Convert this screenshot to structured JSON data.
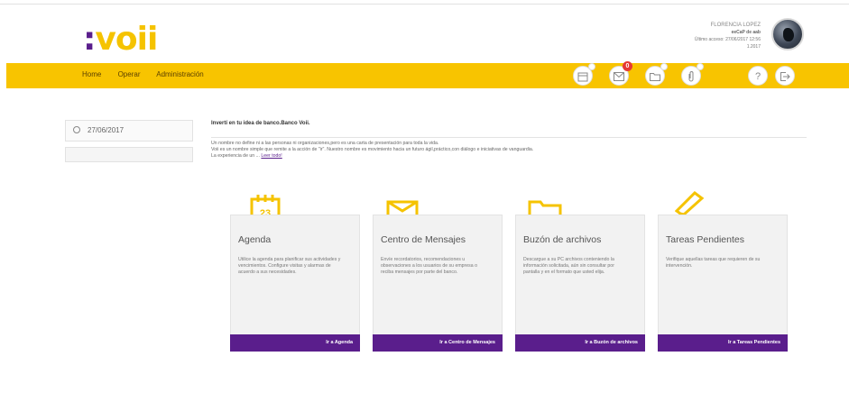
{
  "logo": {
    "colon": ":",
    "text": "voii"
  },
  "user": {
    "name": "FLORENCIA LOPEZ",
    "company": "eeCaP de aab",
    "last_access": "Último acceso: 27/06/2017 12:56",
    "id": "1.2017"
  },
  "nav": {
    "home": "Home",
    "operar": "Operar",
    "admin": "Administración",
    "badge_count": "0"
  },
  "icons": {
    "calendar": "calendar-icon",
    "mail": "mail-icon",
    "folder": "folder-icon",
    "clip": "paperclip-icon",
    "help": "help-icon",
    "logout": "logout-icon"
  },
  "sidebar": {
    "date": "27/06/2017"
  },
  "intro": {
    "title": "Invertí en tu idea de banco.Banco Voii.",
    "line1": "Un nombre no define ni a las personas ni organizaciones,pero es una carta de presentación para toda la vida.",
    "line2": "Voii es un nombre simple que remite a la acción de \"ir\". Nuestro nombre es movimiento hacia un futuro ágil,práctico,con diálogo e iniciativas de vanguardia.",
    "line3": "La experiencia de un ...",
    "more": "Leer todo!"
  },
  "cards": [
    {
      "title": "Agenda",
      "desc": "Utilice la agenda para planificar sus actividades y vencimientos. Configure visitas y alarmas de acuerdo a sus necesidades.",
      "button": "Ir a Agenda"
    },
    {
      "title": "Centro de Mensajes",
      "desc": "Envíe recordatorios, recomendaciones u observaciones a los usuarios de su empresa o reciba mensajes por parte del banco.",
      "button": "Ir a Centro de Mensajes"
    },
    {
      "title": "Buzón de archivos",
      "desc": "Descargue a su PC archivos conteniendo la información solicitada, aún sin consultar por pantalla y en el formato que usted elija.",
      "button": "Ir a Buzón de archivos"
    },
    {
      "title": "Tareas Pendientes",
      "desc": "Verifique aquellas tareas que requieren de su intervención.",
      "button": "Ir a Tareas Pendientes"
    }
  ],
  "colors": {
    "brand_yellow": "#f8c400",
    "brand_purple": "#5a1e8c"
  }
}
